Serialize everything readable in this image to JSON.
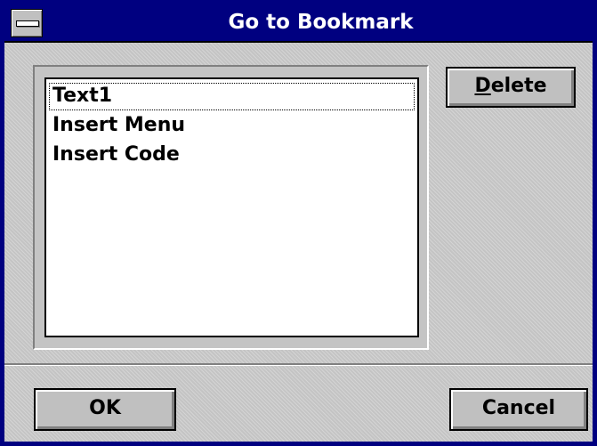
{
  "window": {
    "title": "Go to Bookmark"
  },
  "bookmarks": {
    "items": [
      {
        "label": "Text1"
      },
      {
        "label": "Insert Menu"
      },
      {
        "label": "Insert Code"
      }
    ]
  },
  "buttons": {
    "delete": {
      "mnemonic": "D",
      "rest": "elete"
    },
    "ok": "OK",
    "cancel": "Cancel"
  },
  "colors": {
    "titlebar": "#000080",
    "face": "#c0c0c0",
    "list_bg": "#ffffff"
  },
  "icons": {
    "system_menu": "system-menu-icon"
  }
}
